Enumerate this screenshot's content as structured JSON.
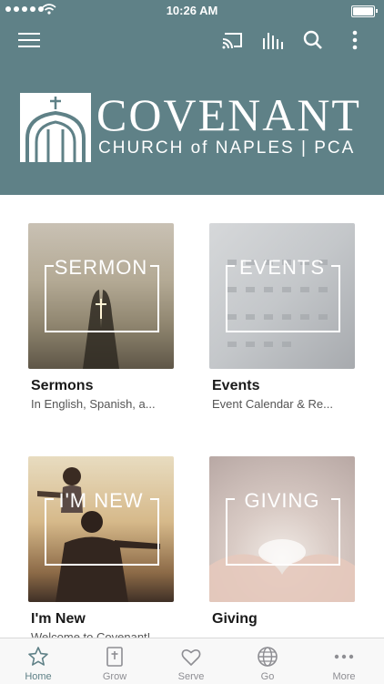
{
  "status_bar": {
    "time": "10:26 AM"
  },
  "header": {
    "logo_title": "COVENANT",
    "logo_subtitle": "CHURCH of NAPLES | PCA",
    "icons": [
      "menu-icon",
      "cast-icon",
      "audio-bars-icon",
      "search-icon",
      "more-vertical-icon"
    ]
  },
  "cards": [
    {
      "image_word": "SERMON",
      "title": "Sermons",
      "subtitle": "In English, Spanish, a..."
    },
    {
      "image_word": "EVENTS",
      "title": "Events",
      "subtitle": "Event Calendar & Re..."
    },
    {
      "image_word": "I'M NEW",
      "title": "I'm New",
      "subtitle": "Welcome to Covenant!"
    },
    {
      "image_word": "GIVING",
      "title": "Giving",
      "subtitle": ""
    }
  ],
  "tabs": [
    {
      "label": "Home",
      "icon": "star-icon",
      "active": true
    },
    {
      "label": "Grow",
      "icon": "bible-icon",
      "active": false
    },
    {
      "label": "Serve",
      "icon": "heart-icon",
      "active": false
    },
    {
      "label": "Go",
      "icon": "globe-icon",
      "active": false
    },
    {
      "label": "More",
      "icon": "more-horizontal-icon",
      "active": false
    }
  ],
  "colors": {
    "brand": "#5f8187",
    "tab_inactive": "#8e8e93"
  }
}
